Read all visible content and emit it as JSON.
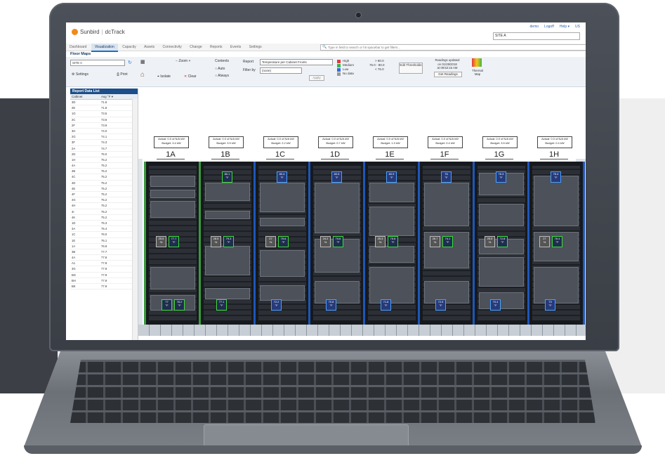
{
  "brand": {
    "company": "Sunbird",
    "product": "dcTrack"
  },
  "top_links": [
    "demo",
    "Logoff",
    "Help ▾",
    "US"
  ],
  "site_select": "SITE A",
  "menu": [
    "Dashboard",
    "Visualization",
    "Capacity",
    "Assets",
    "Connectivity",
    "Change",
    "Reports",
    "Events",
    "Settings"
  ],
  "active_menu": "Visualization",
  "search": {
    "placeholder": "Type in field to search or hit spacebar to get filters..."
  },
  "page_title": "Floor Maps",
  "toolbar": {
    "site": "SITE A",
    "settings": "Settings",
    "print": "Print",
    "zoom": "Zoom",
    "isolate": "Isolate",
    "clear": "Clear",
    "contents": "Contents",
    "auto": "Auto",
    "always": "Always",
    "report_label": "Report",
    "report_value": "Temperature per Cabinet Fronts",
    "filter_label": "Filter by",
    "filter_value": "(none)",
    "apply": "Apply",
    "legend": [
      {
        "label": "High",
        "range": "> 80.0",
        "color": "#e23b3b"
      },
      {
        "label": "Medium",
        "range": "76.0 - 80.0",
        "color": "#3cb44b"
      },
      {
        "label": "Low",
        "range": "< 76.0",
        "color": "#2f6fd6"
      },
      {
        "label": "No data",
        "range": "",
        "color": "#9a9a9a"
      }
    ],
    "edit_thresholds": "Edit Thresholds",
    "readings_line1": "Readings updated",
    "readings_line2": "on 01/29/2018",
    "readings_line3": "at 09:53:16 AM",
    "get_readings": "Get Readings",
    "thermal_map": "Thermal Map"
  },
  "report_list": {
    "title": "Report Data List",
    "col_cabinet": "Cabinet",
    "col_avg": "Avg °F ▾",
    "rows": [
      [
        "3D",
        "71.6"
      ],
      [
        "2E",
        "71.8"
      ],
      [
        "1G",
        "73.5"
      ],
      [
        "2C",
        "73.6"
      ],
      [
        "2F",
        "73.9"
      ],
      [
        "3H",
        "74.0"
      ],
      [
        "2G",
        "74.1"
      ],
      [
        "3F",
        "74.3"
      ],
      [
        "2A",
        "74.7"
      ],
      [
        "2D",
        "75.0"
      ],
      [
        "1H",
        "75.2"
      ],
      [
        "4A",
        "75.2"
      ],
      [
        "4B",
        "75.2"
      ],
      [
        "4C",
        "75.2"
      ],
      [
        "4D",
        "75.2"
      ],
      [
        "4E",
        "75.2"
      ],
      [
        "4F",
        "75.2"
      ],
      [
        "4G",
        "75.2"
      ],
      [
        "4H",
        "75.2"
      ],
      [
        "4I",
        "75.2"
      ],
      [
        "4K",
        "75.2"
      ],
      [
        "1D",
        "75.3"
      ],
      [
        "3A",
        "75.4"
      ],
      [
        "1C",
        "76.0"
      ],
      [
        "1E",
        "76.1"
      ],
      [
        "1A",
        "76.9"
      ],
      [
        "3B",
        "77.7"
      ],
      [
        "4A",
        "77.8"
      ],
      [
        "A1",
        "77.8"
      ],
      [
        "3G",
        "77.9"
      ],
      [
        "BG",
        "77.9"
      ],
      [
        "BH",
        "77.9"
      ],
      [
        "BK",
        "77.9"
      ]
    ]
  },
  "cabinets": [
    {
      "name": "1A",
      "actual": "Actual: 0.0 of N/A kW",
      "budget": "Budget: 3.4 kW",
      "top": "",
      "mid_a": "25.5\n%",
      "mid_b": "77.7\n°F",
      "bot_a": "77\n°F",
      "bot_b": "76.2\n°F",
      "color": "green"
    },
    {
      "name": "1B",
      "actual": "Actual: 0.0 of N/A kW",
      "budget": "Budget: 3.9 kW",
      "top": "80.1\n°F",
      "mid_a": "28.5\n%",
      "mid_b": "79.3\n°F",
      "bot_a": "77.1\n°F",
      "bot_b": "",
      "color": "green"
    },
    {
      "name": "1C",
      "actual": "Actual: 0.0 of N/A kW",
      "budget": "Budget: 2.2 kW",
      "top": "80.4\n°F",
      "mid_a": "27\n%",
      "mid_b": "75.6\n°F",
      "bot_a": "72.2\n°F",
      "bot_b": "",
      "color": "blue"
    },
    {
      "name": "1D",
      "actual": "Actual: 0.0 of N/A kW",
      "budget": "Budget: 0.7 kW",
      "top": "80.5\n°F",
      "mid_a": "24.2\n%",
      "mid_b": "74.6\n°F",
      "bot_a": "70.8\n°F",
      "bot_b": "",
      "color": "blue"
    },
    {
      "name": "1E",
      "actual": "Actual: 0.0 of N/A kW",
      "budget": "Budget: 1.3 kW",
      "top": "80.9\n°F",
      "mid_a": "25.3\n%",
      "mid_b": "75.8\n°F",
      "bot_a": "71.8\n°F",
      "bot_b": "",
      "color": "blue"
    },
    {
      "name": "1F",
      "actual": "Actual: 0.0 of N/A kW",
      "budget": "Budget: 0.4 kW",
      "top": "76\n°F",
      "mid_a": "26.7\n%",
      "mid_b": "74.1\n°F",
      "bot_a": "72.5\n°F",
      "bot_b": "",
      "color": "blue"
    },
    {
      "name": "1G",
      "actual": "Actual: 0.0 of N/A kW",
      "budget": "Budget: 3.5 kW",
      "top": "76.3\n°F",
      "mid_a": "25.5\n%",
      "mid_b": "72.8\n°F",
      "bot_a": "70.4\n°F",
      "bot_b": "",
      "color": "blue"
    },
    {
      "name": "1H",
      "actual": "Actual: 0.0 of N/A kW",
      "budget": "Budget: 0.4 kW",
      "top": "76.4\n°F",
      "mid_a": "27\n%",
      "mid_b": "76.4\n°F",
      "bot_a": "73\n°F",
      "bot_b": "",
      "color": "blue"
    }
  ]
}
